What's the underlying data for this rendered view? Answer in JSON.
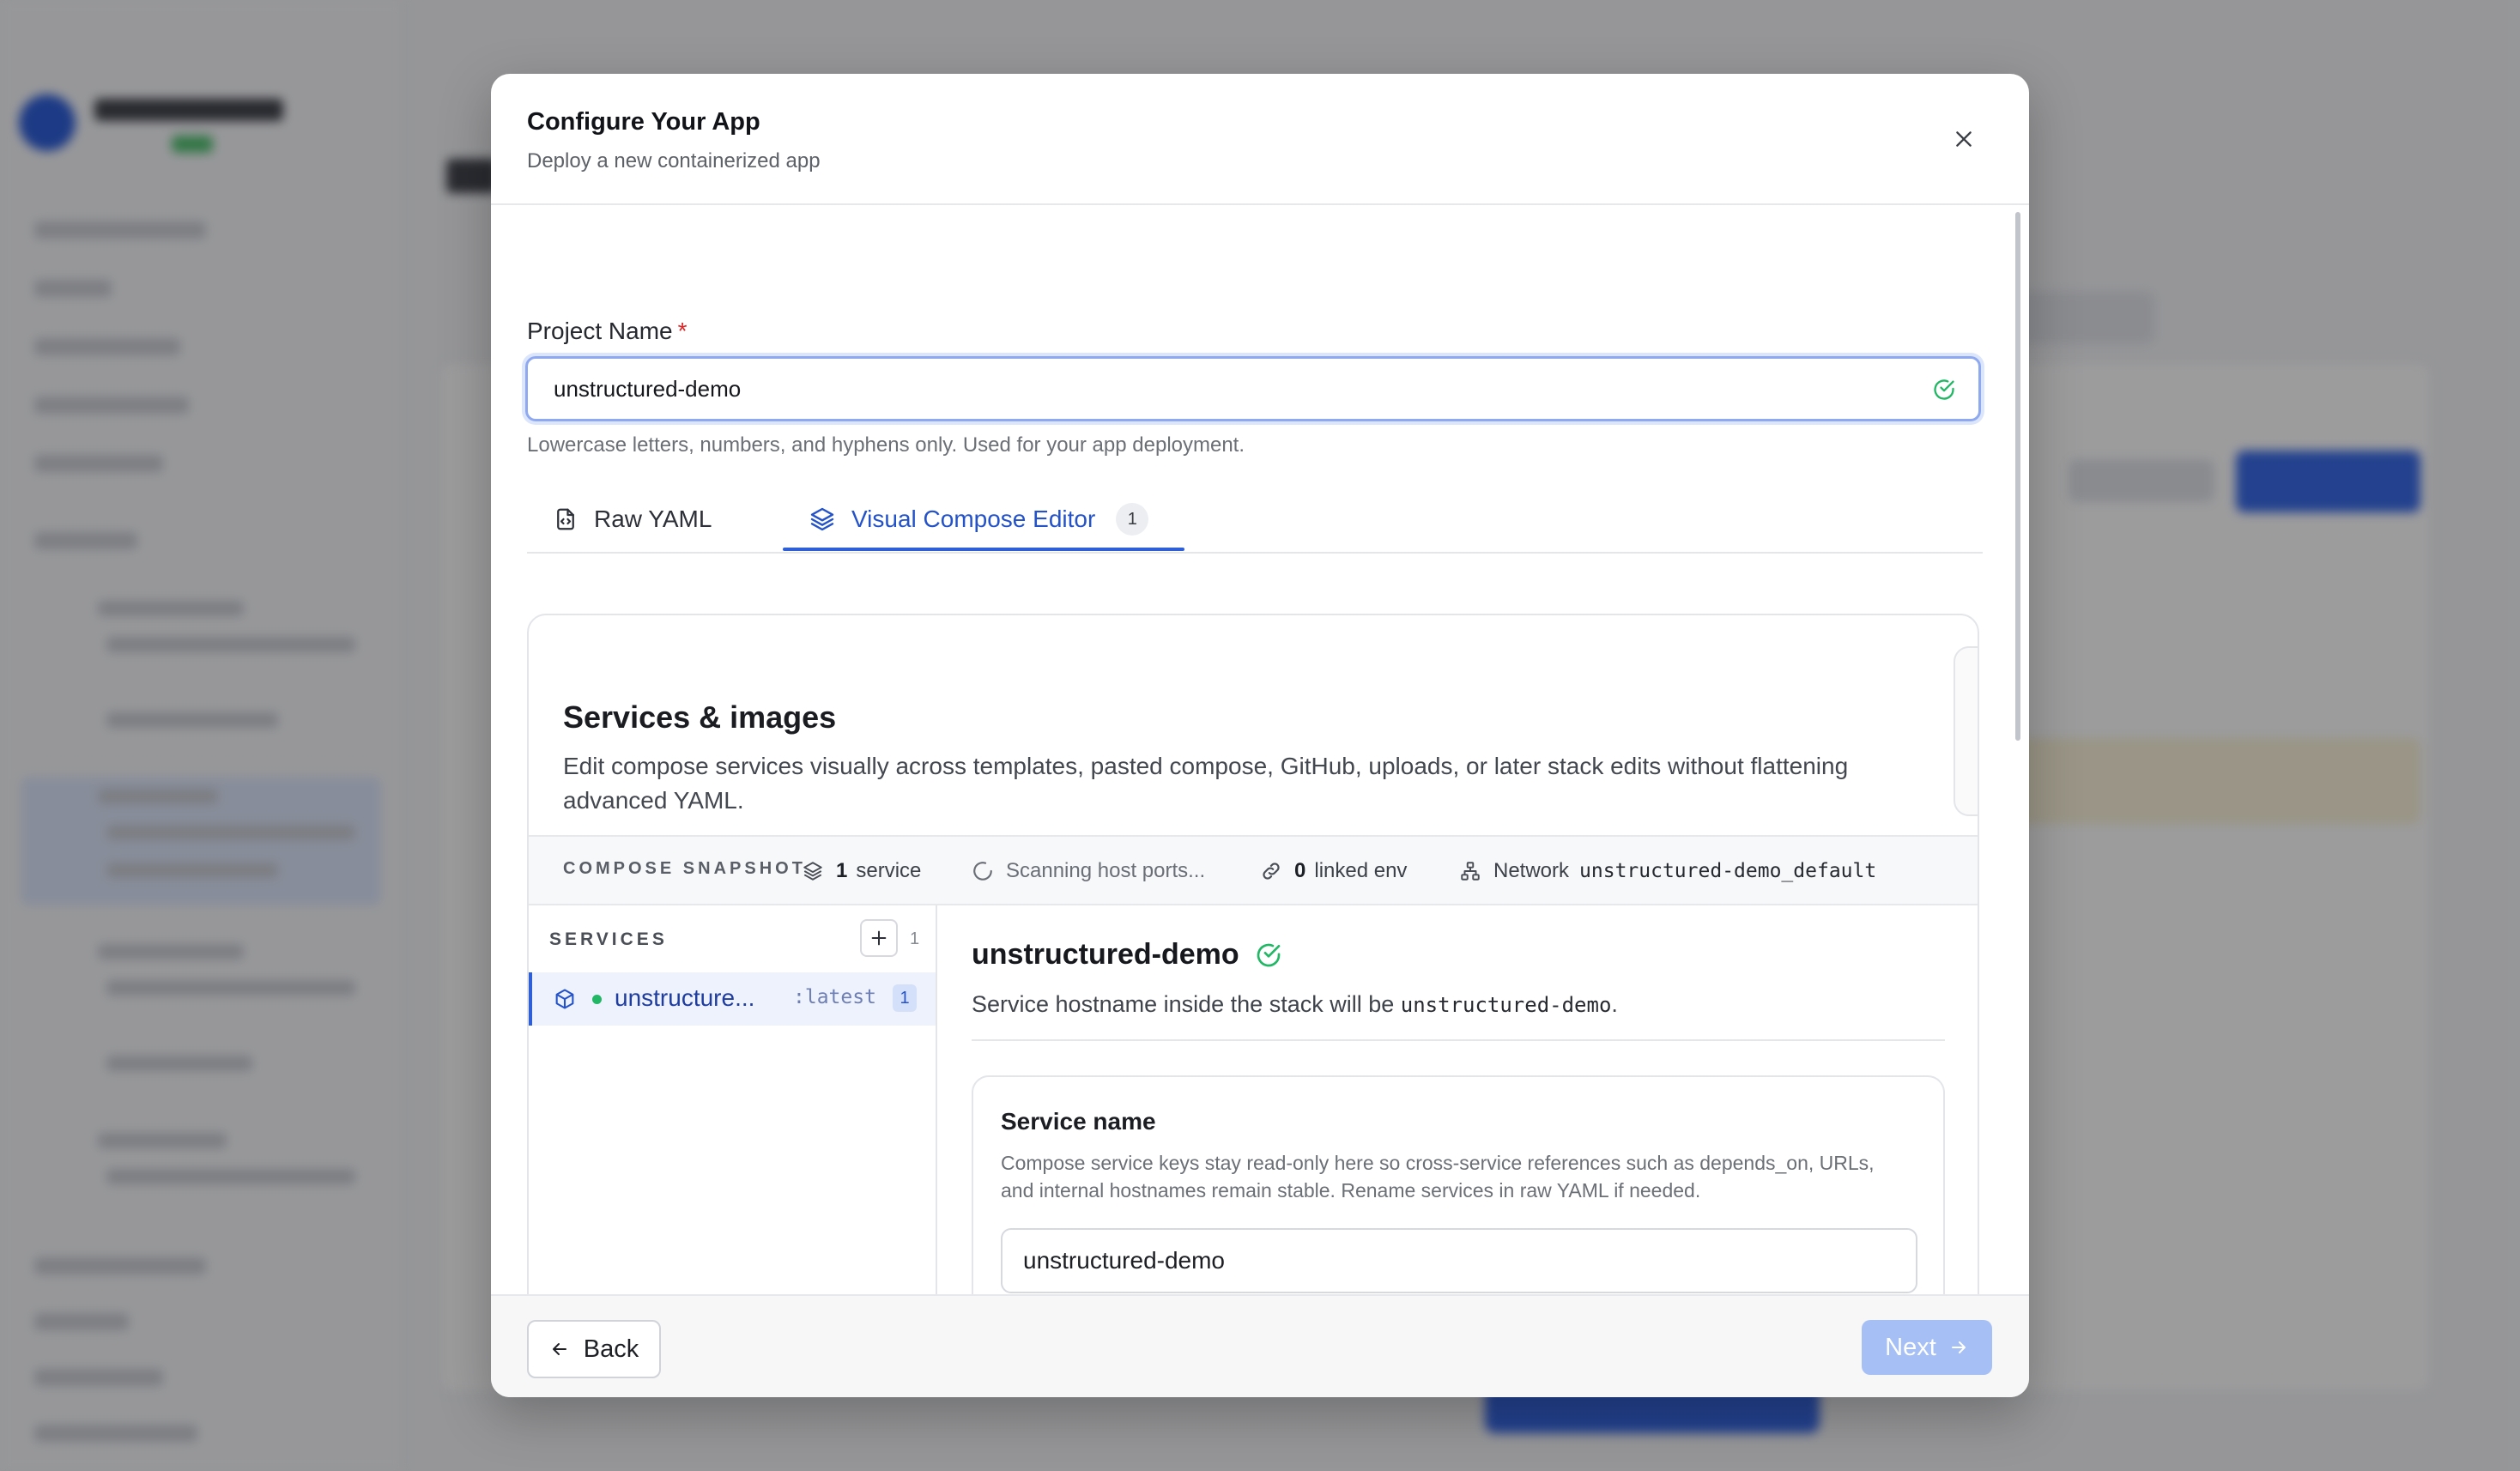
{
  "colors": {
    "accent": "#2f5ed9",
    "success": "#22b765",
    "required": "#dc2626",
    "next_disabled": "#a6bff5"
  },
  "modal": {
    "title": "Configure Your App",
    "subtitle": "Deploy a new containerized app",
    "close_icon": "close-icon"
  },
  "project": {
    "label": "Project Name",
    "required_mark": "*",
    "value": "unstructured-demo",
    "hint": "Lowercase letters, numbers, and hyphens only. Used for your app deployment.",
    "status_icon": "check-circle-icon"
  },
  "tabs": [
    {
      "label": "Raw YAML",
      "icon": "file-code-icon",
      "active": false
    },
    {
      "label": "Visual Compose Editor",
      "icon": "layers-icon",
      "badge": "1",
      "active": true
    }
  ],
  "editor": {
    "title": "Services & images",
    "description": "Edit compose services visually across templates, pasted compose, GitHub, uploads, or later stack edits without flattening advanced YAML."
  },
  "snapshot": {
    "label": "COMPOSE SNAPSHOT",
    "services_count": "1",
    "services_word": "service",
    "ports_status": "Scanning host ports...",
    "env_count": "0",
    "env_word": "linked env",
    "network_label": "Network",
    "network_name": "unstructured-demo_default"
  },
  "services": {
    "label": "SERVICES",
    "count": "1",
    "items": [
      {
        "name": "unstructure...",
        "tag": ":latest",
        "badge": "1",
        "status": "running"
      }
    ]
  },
  "detail": {
    "title": "unstructured-demo",
    "hostname_prefix": "Service hostname inside the stack will be",
    "hostname": "unstructured-demo",
    "hostname_suffix": ".",
    "service_name_title": "Service name",
    "service_name_help": "Compose service keys stay read-only here so cross-service references such as depends_on, URLs, and internal hostnames remain stable. Rename services in raw YAML if needed.",
    "service_name_value": "unstructured-demo"
  },
  "footer": {
    "back_label": "Back",
    "next_label": "Next"
  }
}
